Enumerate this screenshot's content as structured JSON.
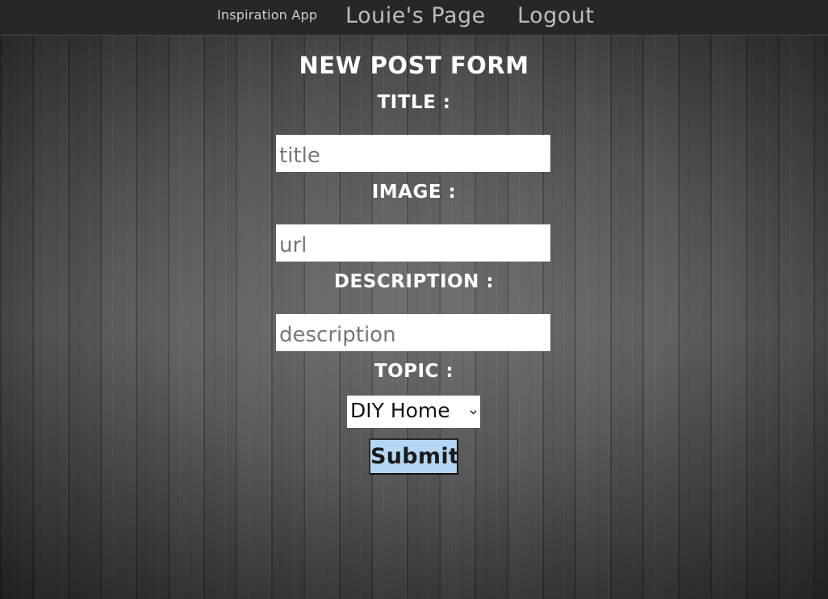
{
  "navbar": {
    "brand": "Inspiration App",
    "profile_link": "Louie's Page",
    "logout_link": "Logout"
  },
  "form": {
    "heading": "NEW POST FORM",
    "title_label": "TITLE :",
    "title_placeholder": "title",
    "image_label": "IMAGE :",
    "image_placeholder": "url",
    "description_label": "DESCRIPTION :",
    "description_placeholder": "description",
    "topic_label": "TOPIC :",
    "topic_selected": "DIY Home",
    "submit_label": "Submit"
  },
  "colors": {
    "navbar_bg": "#272727",
    "submit_bg": "#b4d6f2",
    "label_text": "#ffffff"
  },
  "icons": {
    "select_arrow": "chevron-down-icon"
  }
}
